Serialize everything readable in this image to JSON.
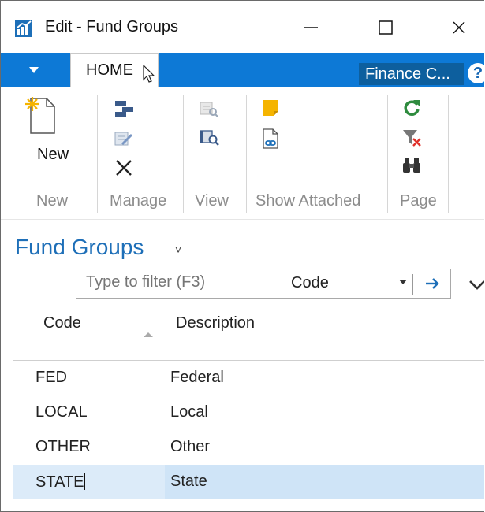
{
  "window": {
    "title": "Edit - Fund Groups",
    "minimize_glyph": "—",
    "maximize_glyph": "☐",
    "close_glyph": "✕"
  },
  "ribbon_tabs": {
    "home": "HOME",
    "company": "Finance C...",
    "help": "?"
  },
  "ribbon": {
    "new_button": "New",
    "groups": {
      "new": "New",
      "manage": "Manage",
      "view": "View",
      "show_attached": "Show Attached",
      "page": "Page"
    }
  },
  "page": {
    "title": "Fund Groups",
    "title_dropdown": "˅"
  },
  "filter": {
    "placeholder": "Type to filter (F3)",
    "field": "Code"
  },
  "table": {
    "columns": [
      "Code",
      "Description"
    ],
    "rows": [
      {
        "code": "FED",
        "description": "Federal"
      },
      {
        "code": "LOCAL",
        "description": "Local"
      },
      {
        "code": "OTHER",
        "description": "Other"
      },
      {
        "code": "STATE",
        "description": "State"
      }
    ],
    "selected_row": 3,
    "sorted_column": "Code"
  },
  "colors": {
    "accent": "#0d79d6",
    "company_badge": "#0d5f9e",
    "page_title": "#1e6fb8",
    "selected_row": "#cfe4f7"
  },
  "icons": [
    "app-icon",
    "file-tab-arrow-icon",
    "new-document-icon",
    "edit-list-icon",
    "edit-icon",
    "delete-icon",
    "view-icon",
    "view-list-icon",
    "notes-icon",
    "links-icon",
    "refresh-icon",
    "clear-filter-icon",
    "find-icon",
    "arrow-right-icon",
    "chevron-down-icon",
    "mouse-cursor-icon"
  ]
}
